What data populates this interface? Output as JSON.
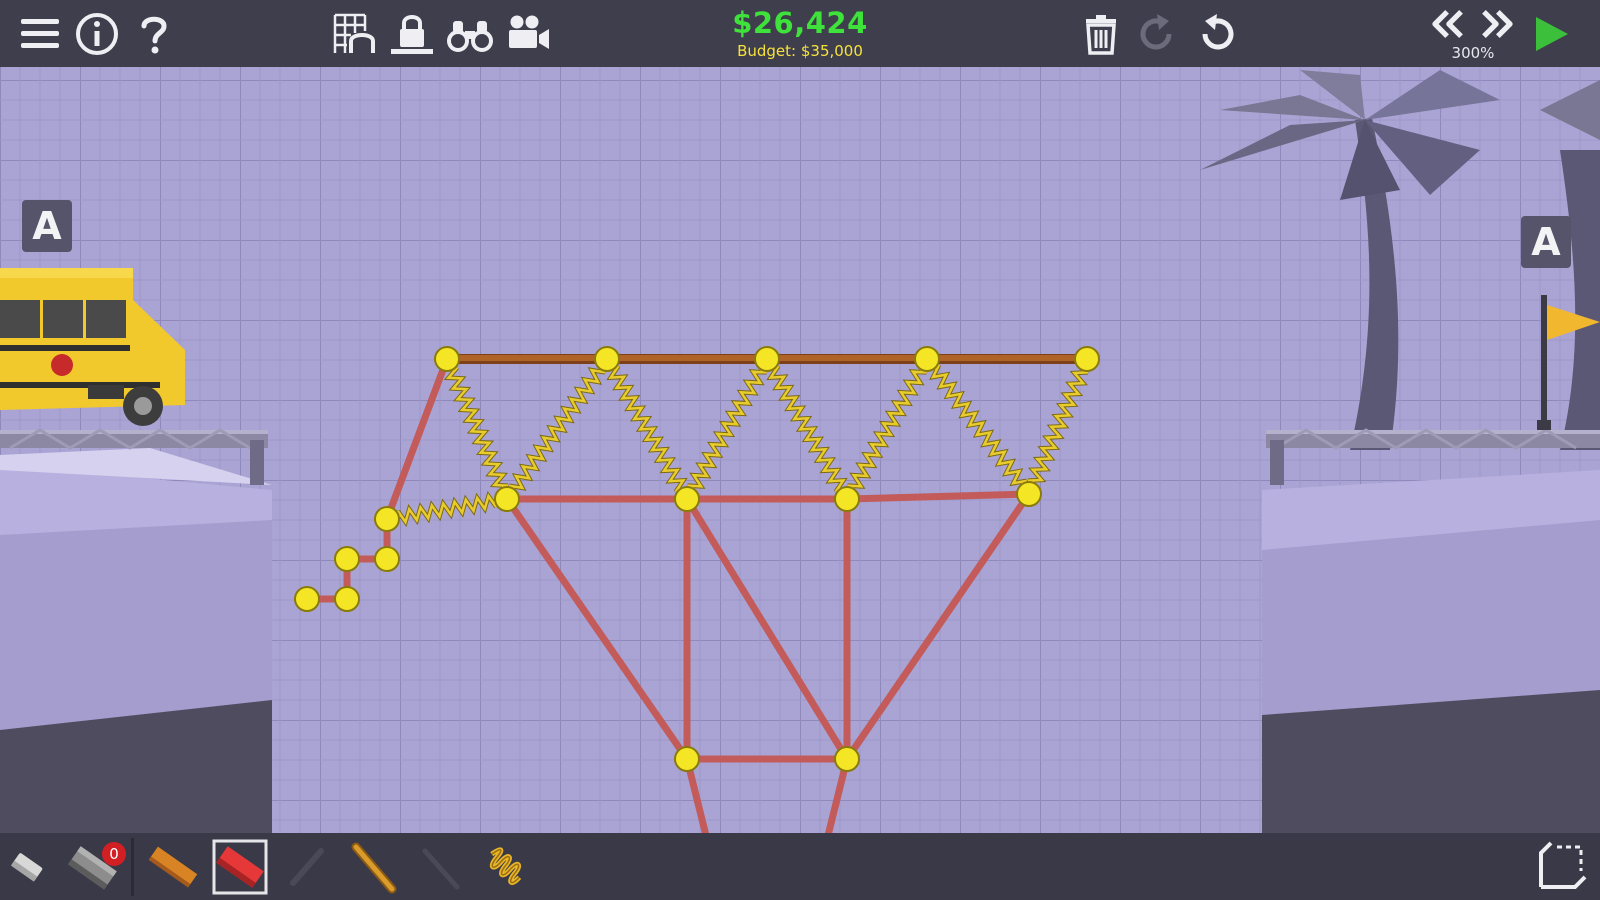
{
  "hud": {
    "cost": "$26,424",
    "budget": "Budget: $35,000",
    "speed": "300%"
  },
  "anchors": {
    "left_label": "A",
    "right_label": "A"
  },
  "toolbar_icons": [
    "menu-icon",
    "info-icon",
    "help-icon",
    "grid-icon",
    "anchor-lock-icon",
    "binoculars-icon",
    "camera-icon",
    "trash-icon",
    "redo-icon",
    "undo-icon",
    "rewind-icon",
    "fast-forward-icon",
    "play-icon"
  ],
  "materials": {
    "road_badge_count": "0",
    "items": [
      "eraser",
      "road",
      "wood-road",
      "reinforced-road",
      "rope",
      "wood",
      "cable",
      "spring"
    ]
  },
  "colors": {
    "cost": "#3ee23a",
    "budget": "#f5e33a",
    "steel": "#c25b59",
    "joint": "#f4e625",
    "spring": "#e8cc2e",
    "wood": "#b06327",
    "play": "#3cc03c",
    "hud_bg": "#3f3e4d"
  }
}
